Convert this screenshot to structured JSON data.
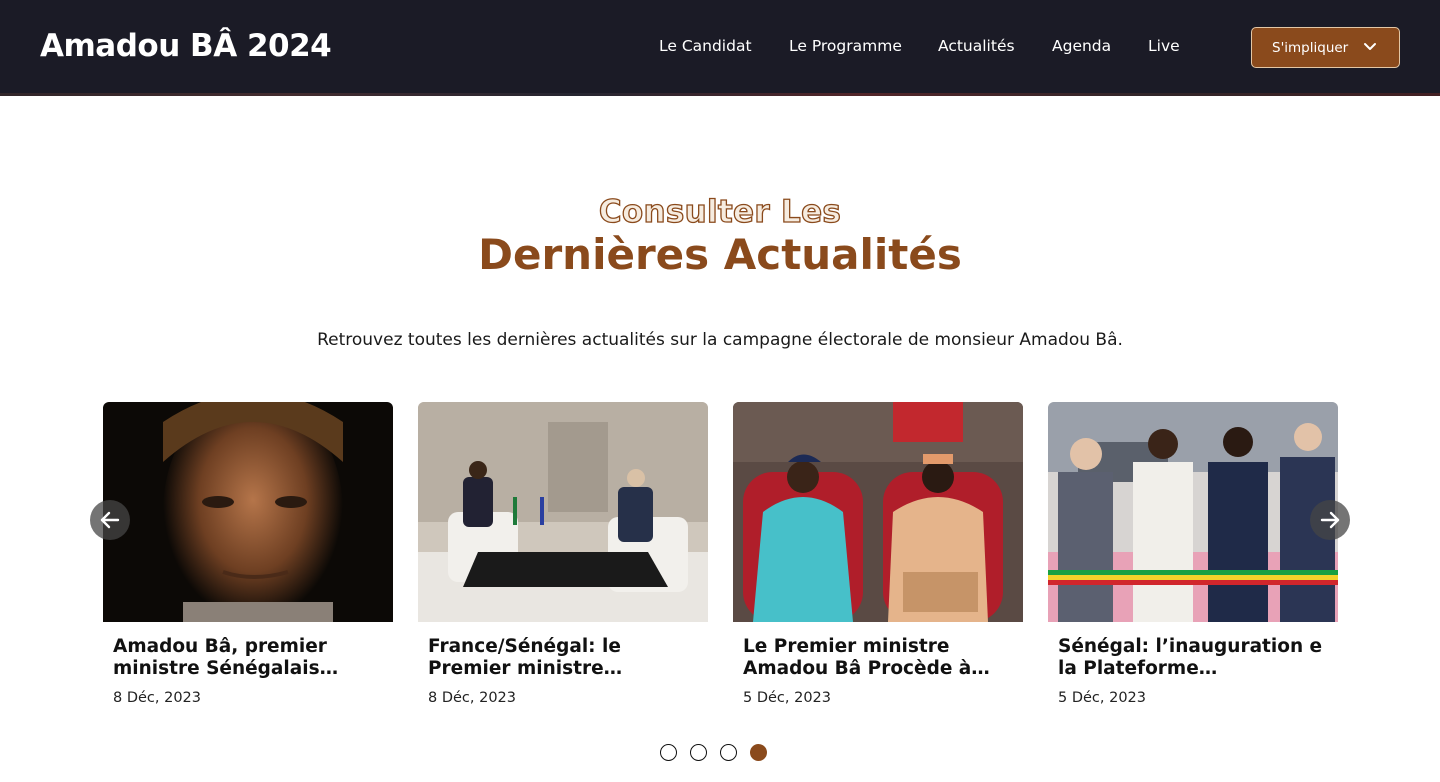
{
  "header": {
    "brand": "Amadou BÂ 2024",
    "nav": [
      "Le Candidat",
      "Le Programme",
      "Actualités",
      "Agenda",
      "Live"
    ],
    "cta_label": "S'impliquer",
    "cta_icon": "chevron-down-icon"
  },
  "section": {
    "eyebrow": "Consulter Les",
    "title": "Dernières Actualités",
    "lead": "Retrouvez toutes les dernières actualités sur la campagne électorale de monsieur Amadou Bâ."
  },
  "carousel": {
    "prev_icon": "arrow-left-icon",
    "next_icon": "arrow-right-icon",
    "cards": [
      {
        "title": "Amadou Bâ, premier ministre Sénégalais rencontre…",
        "date": "8 Déc, 2023"
      },
      {
        "title": "France/Sénégal: le Premier ministre Amadou…",
        "date": "8 Déc, 2023"
      },
      {
        "title": "Le Premier ministre Amadou Bâ Procède à…",
        "date": "5 Déc, 2023"
      },
      {
        "title": "Sénégal: l’inauguration e la Plateforme Industrielle…",
        "date": "5 Déc, 2023"
      }
    ],
    "dots_count": 4,
    "active_dot": 4
  },
  "colors": {
    "header_bg": "#1b1b26",
    "accent": "#8a4a1c"
  }
}
